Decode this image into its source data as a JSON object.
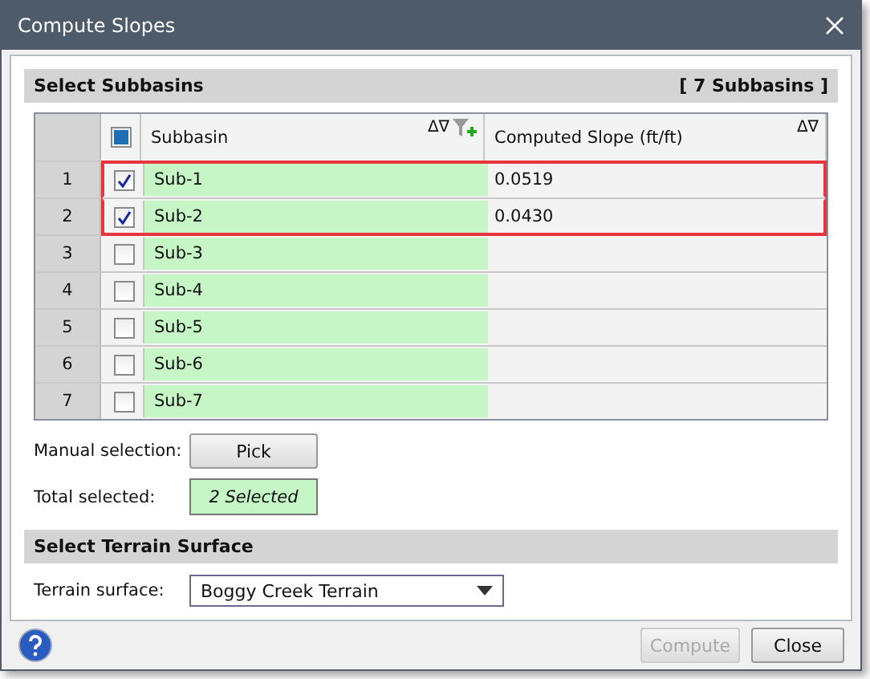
{
  "window": {
    "title": "Compute Slopes"
  },
  "subbasins_section": {
    "title": "Select Subbasins",
    "count": "[ 7 Subbasins ]"
  },
  "table": {
    "header_checkbox_mixed": true,
    "columns": [
      {
        "label": "Subbasin",
        "sort_glyph": "Δ∇"
      },
      {
        "label": "Computed Slope (ft/ft)",
        "sort_glyph": "Δ∇"
      }
    ],
    "rows": [
      {
        "number": "1",
        "checked": true,
        "name": "Sub-1",
        "slope": "0.0519",
        "highlighted": true
      },
      {
        "number": "2",
        "checked": true,
        "name": "Sub-2",
        "slope": "0.0430",
        "highlighted": true
      },
      {
        "number": "3",
        "checked": false,
        "name": "Sub-3",
        "highlighted": false
      },
      {
        "number": "4",
        "checked": false,
        "name": "Sub-4",
        "highlighted": false
      },
      {
        "number": "5",
        "checked": false,
        "name": "Sub-5",
        "highlighted": false
      },
      {
        "number": "6",
        "checked": false,
        "name": "Sub-6",
        "highlighted": false
      },
      {
        "number": "7",
        "checked": false,
        "name": "Sub-7",
        "highlighted": false
      }
    ]
  },
  "manual_selection": {
    "label": "Manual selection:",
    "button": "Pick"
  },
  "total_selected": {
    "label": "Total selected:",
    "value": "2 Selected"
  },
  "terrain_section": {
    "title": "Select Terrain Surface"
  },
  "terrain": {
    "label": "Terrain surface:",
    "value": "Boggy Creek Terrain"
  },
  "buttons": [
    {
      "label": "Compute",
      "disabled": true
    },
    {
      "label": "Close",
      "disabled": false
    }
  ]
}
